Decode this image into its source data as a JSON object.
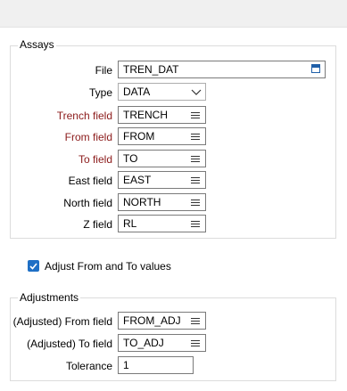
{
  "assays": {
    "title": "Assays",
    "file_label": "File",
    "file_value": "TREN_DAT",
    "type_label": "Type",
    "type_value": "DATA",
    "trench_label": "Trench field",
    "trench_value": "TRENCH",
    "from_label": "From field",
    "from_value": "FROM",
    "to_label": "To field",
    "to_value": "TO",
    "east_label": "East field",
    "east_value": "EAST",
    "north_label": "North field",
    "north_value": "NORTH",
    "z_label": "Z field",
    "z_value": "RL"
  },
  "adjust_checkbox": {
    "label": "Adjust From and To values",
    "checked": true
  },
  "adjustments": {
    "title": "Adjustments",
    "adj_from_label": "(Adjusted) From field",
    "adj_from_value": "FROM_ADJ",
    "adj_to_label": "(Adjusted) To field",
    "adj_to_value": "TO_ADJ",
    "tolerance_label": "Tolerance",
    "tolerance_value": "1"
  },
  "colors": {
    "required_label": "#8b1a1a",
    "checkbox_accent": "#1f6fc5",
    "file_icon": "#1f5fa8"
  },
  "icons": {
    "file_browse": "file-browse-icon",
    "list": "list-icon",
    "chevron": "chevron-down-icon",
    "check": "check-icon"
  }
}
